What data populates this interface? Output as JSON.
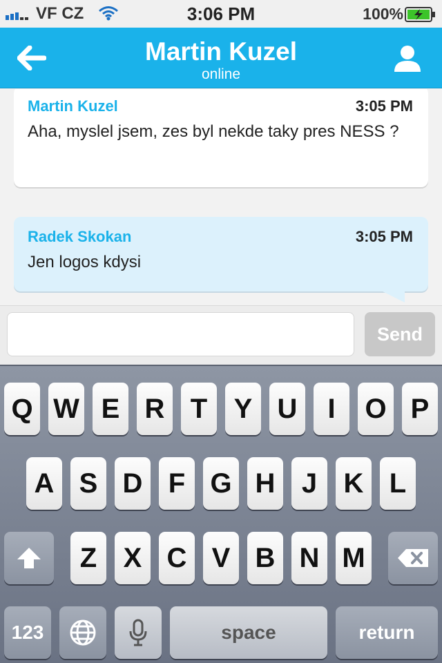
{
  "status_bar": {
    "carrier": "VF CZ",
    "time": "3:06 PM",
    "battery": "100%"
  },
  "nav": {
    "title": "Martin Kuzel",
    "subtitle": "online"
  },
  "messages": [
    {
      "sender": "Martin Kuzel",
      "time": "3:05 PM",
      "text": "Aha, myslel jsem, zes byl nekde taky pres NESS ?"
    },
    {
      "sender": "Radek Skokan",
      "time": "3:05 PM",
      "text": "Jen logos kdysi"
    }
  ],
  "composer": {
    "placeholder": "",
    "send_label": "Send"
  },
  "keyboard": {
    "row1": [
      "Q",
      "W",
      "E",
      "R",
      "T",
      "Y",
      "U",
      "I",
      "O",
      "P"
    ],
    "row2": [
      "A",
      "S",
      "D",
      "F",
      "G",
      "H",
      "J",
      "K",
      "L"
    ],
    "row3": [
      "Z",
      "X",
      "C",
      "V",
      "B",
      "N",
      "M"
    ],
    "numbers_label": "123",
    "space_label": "space",
    "return_label": "return"
  },
  "colors": {
    "accent": "#1ab2ea",
    "outgoing_bubble": "#dcf1fc"
  }
}
